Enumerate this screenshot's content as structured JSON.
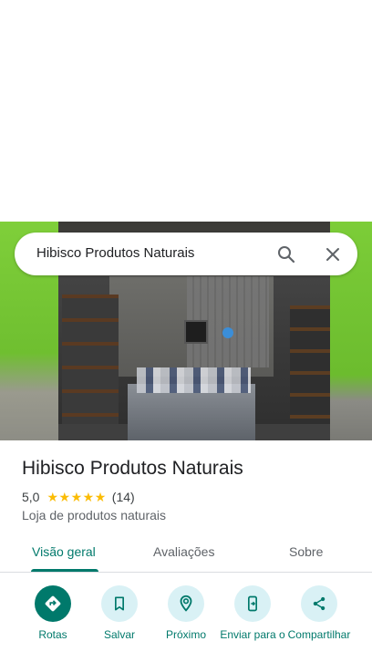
{
  "search": {
    "query": "Hibisco Produtos Naturais"
  },
  "place": {
    "name": "Hibisco Produtos Naturais",
    "rating": "5,0",
    "stars": 5,
    "review_count": "(14)",
    "category": "Loja de produtos naturais"
  },
  "tabs": [
    {
      "label": "Visão geral",
      "active": true
    },
    {
      "label": "Avaliações",
      "active": false
    },
    {
      "label": "Sobre",
      "active": false
    }
  ],
  "actions": [
    {
      "label": "Rotas",
      "icon": "directions-icon"
    },
    {
      "label": "Salvar",
      "icon": "bookmark-icon"
    },
    {
      "label": "Próximo",
      "icon": "nearby-icon"
    },
    {
      "label": "Enviar para o",
      "icon": "send-to-phone-icon"
    },
    {
      "label": "Compartilhar",
      "icon": "share-icon"
    }
  ],
  "colors": {
    "accent": "#00796b",
    "action_bg": "#d9f1f5",
    "star": "#fbbc04"
  }
}
